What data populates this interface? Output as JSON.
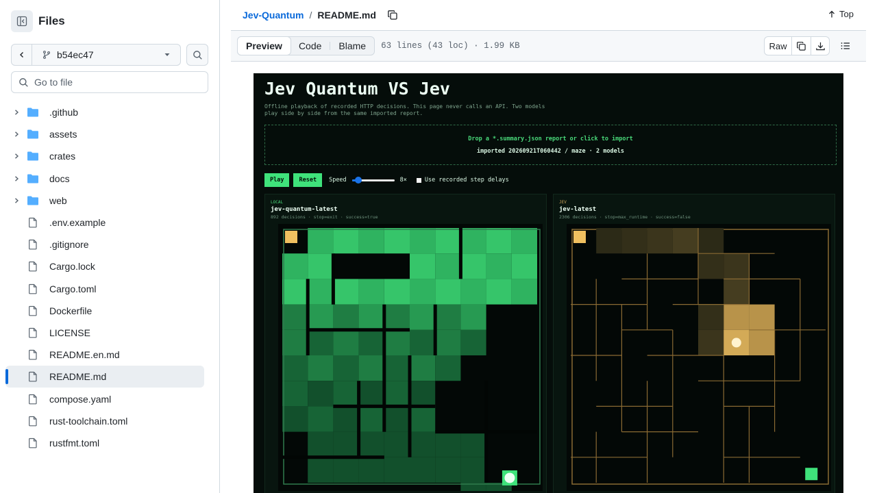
{
  "sidebar": {
    "title": "Files",
    "branch": "b54ec47",
    "goto_placeholder": "Go to file",
    "items": [
      {
        "label": ".github",
        "type": "folder"
      },
      {
        "label": "assets",
        "type": "folder"
      },
      {
        "label": "crates",
        "type": "folder"
      },
      {
        "label": "docs",
        "type": "folder"
      },
      {
        "label": "web",
        "type": "folder"
      },
      {
        "label": ".env.example",
        "type": "file"
      },
      {
        "label": ".gitignore",
        "type": "file"
      },
      {
        "label": "Cargo.lock",
        "type": "file"
      },
      {
        "label": "Cargo.toml",
        "type": "file"
      },
      {
        "label": "Dockerfile",
        "type": "file"
      },
      {
        "label": "LICENSE",
        "type": "file"
      },
      {
        "label": "README.en.md",
        "type": "file"
      },
      {
        "label": "README.md",
        "type": "file",
        "active": true
      },
      {
        "label": "compose.yaml",
        "type": "file"
      },
      {
        "label": "rust-toolchain.toml",
        "type": "file"
      },
      {
        "label": "rustfmt.toml",
        "type": "file"
      }
    ]
  },
  "header": {
    "repo": "Jev-Quantum",
    "separator": "/",
    "file": "README.md",
    "top_label": "Top"
  },
  "toolbar": {
    "tabs": [
      "Preview",
      "Code",
      "Blame"
    ],
    "selected_tab": "Preview",
    "meta": "63 lines (43 loc) · 1.99 KB",
    "raw_label": "Raw"
  },
  "preview": {
    "title": "Jev Quantum VS Jev",
    "subtitle": "Offline playback of recorded HTTP decisions. This page never calls an API. Two models play side by side from the same imported report.",
    "drop_text": "Drop a *.summary.json report or click to import",
    "imported_text": "imported 20260921T060442 / maze · 2 models",
    "play_label": "Play",
    "reset_label": "Reset",
    "speed_label": "Speed",
    "speed_value": "8×",
    "speed_fraction": 0.15,
    "delays_label": "Use recorded step delays",
    "panels": [
      {
        "tag": "LOCAL",
        "name": "jev-quantum-latest",
        "stats": "892 decisions · stop=exit · success=true",
        "accent": "#3fcf74"
      },
      {
        "tag": "JEV",
        "name": "jev-latest",
        "stats": "2306 decisions · stop=max_runtime · success=false",
        "accent": "#b8934a"
      }
    ]
  },
  "colors": {
    "link": "#0969da",
    "accent_green": "#3fe27b",
    "maze_gold": "#c8a25a",
    "start_tile": "#f0c060"
  }
}
